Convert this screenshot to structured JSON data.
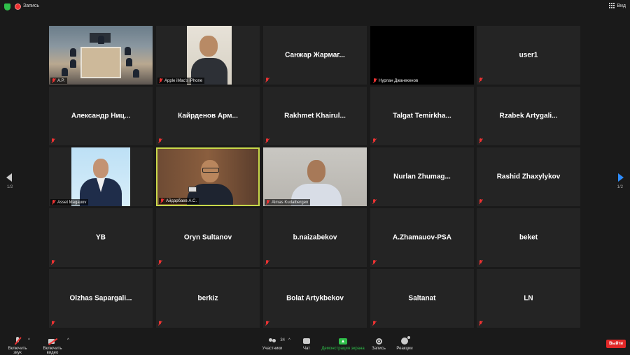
{
  "topbar": {
    "record_label": "Запись",
    "view_label": "Вид"
  },
  "tiles": [
    {
      "type": "video",
      "video": "v-room",
      "label": "A.P."
    },
    {
      "type": "video",
      "video": "v-apple",
      "label": "Apple iMac's iPhone"
    },
    {
      "type": "name",
      "name": "Санжар Жармаг..."
    },
    {
      "type": "video",
      "video": "v-nur",
      "label": "Нурлан Джанекенов"
    },
    {
      "type": "name",
      "name": "user1"
    },
    {
      "type": "name",
      "name": "Александр Ниц..."
    },
    {
      "type": "name",
      "name": "Кайрденов Арм..."
    },
    {
      "type": "name",
      "name": "Rakhmet Khairul..."
    },
    {
      "type": "name",
      "name": "Talgat Temirkha..."
    },
    {
      "type": "name",
      "name": "Rzabek Artygali..."
    },
    {
      "type": "video",
      "video": "v-asset",
      "label": "Asset Magauov"
    },
    {
      "type": "video",
      "video": "v-aid",
      "label": "Айдарбаев А.С.",
      "active": true
    },
    {
      "type": "video",
      "video": "v-alm",
      "label": "Almas Kudaibergen"
    },
    {
      "type": "name",
      "name": "Nurlan Zhumag..."
    },
    {
      "type": "name",
      "name": "Rashid Zhaxylykov"
    },
    {
      "type": "name",
      "name": "YB"
    },
    {
      "type": "name",
      "name": "Oryn Sultanov"
    },
    {
      "type": "name",
      "name": "b.naizabekov"
    },
    {
      "type": "name",
      "name": "A.Zhamauov-PSA"
    },
    {
      "type": "name",
      "name": "beket"
    },
    {
      "type": "name",
      "name": "Olzhas Sapargali..."
    },
    {
      "type": "name",
      "name": "berkiz"
    },
    {
      "type": "name",
      "name": "Bolat Artykbekov"
    },
    {
      "type": "name",
      "name": "Saltanat"
    },
    {
      "type": "name",
      "name": "LN"
    }
  ],
  "pager": {
    "left": "1/2",
    "right": "1/2"
  },
  "toolbar": {
    "mic_label": "Включить звук",
    "video_label": "Включить видео",
    "participants_label": "Участники",
    "participants_count": "34",
    "chat_label": "Чат",
    "share_label": "Демонстрация экрана",
    "record_label": "Запись",
    "reactions_label": "Реакции",
    "leave_label": "Выйти"
  },
  "colors": {
    "accent": "#2d8cff",
    "share": "#2fbf4a",
    "leave": "#e02828",
    "active_speaker": "#c8d94a"
  }
}
